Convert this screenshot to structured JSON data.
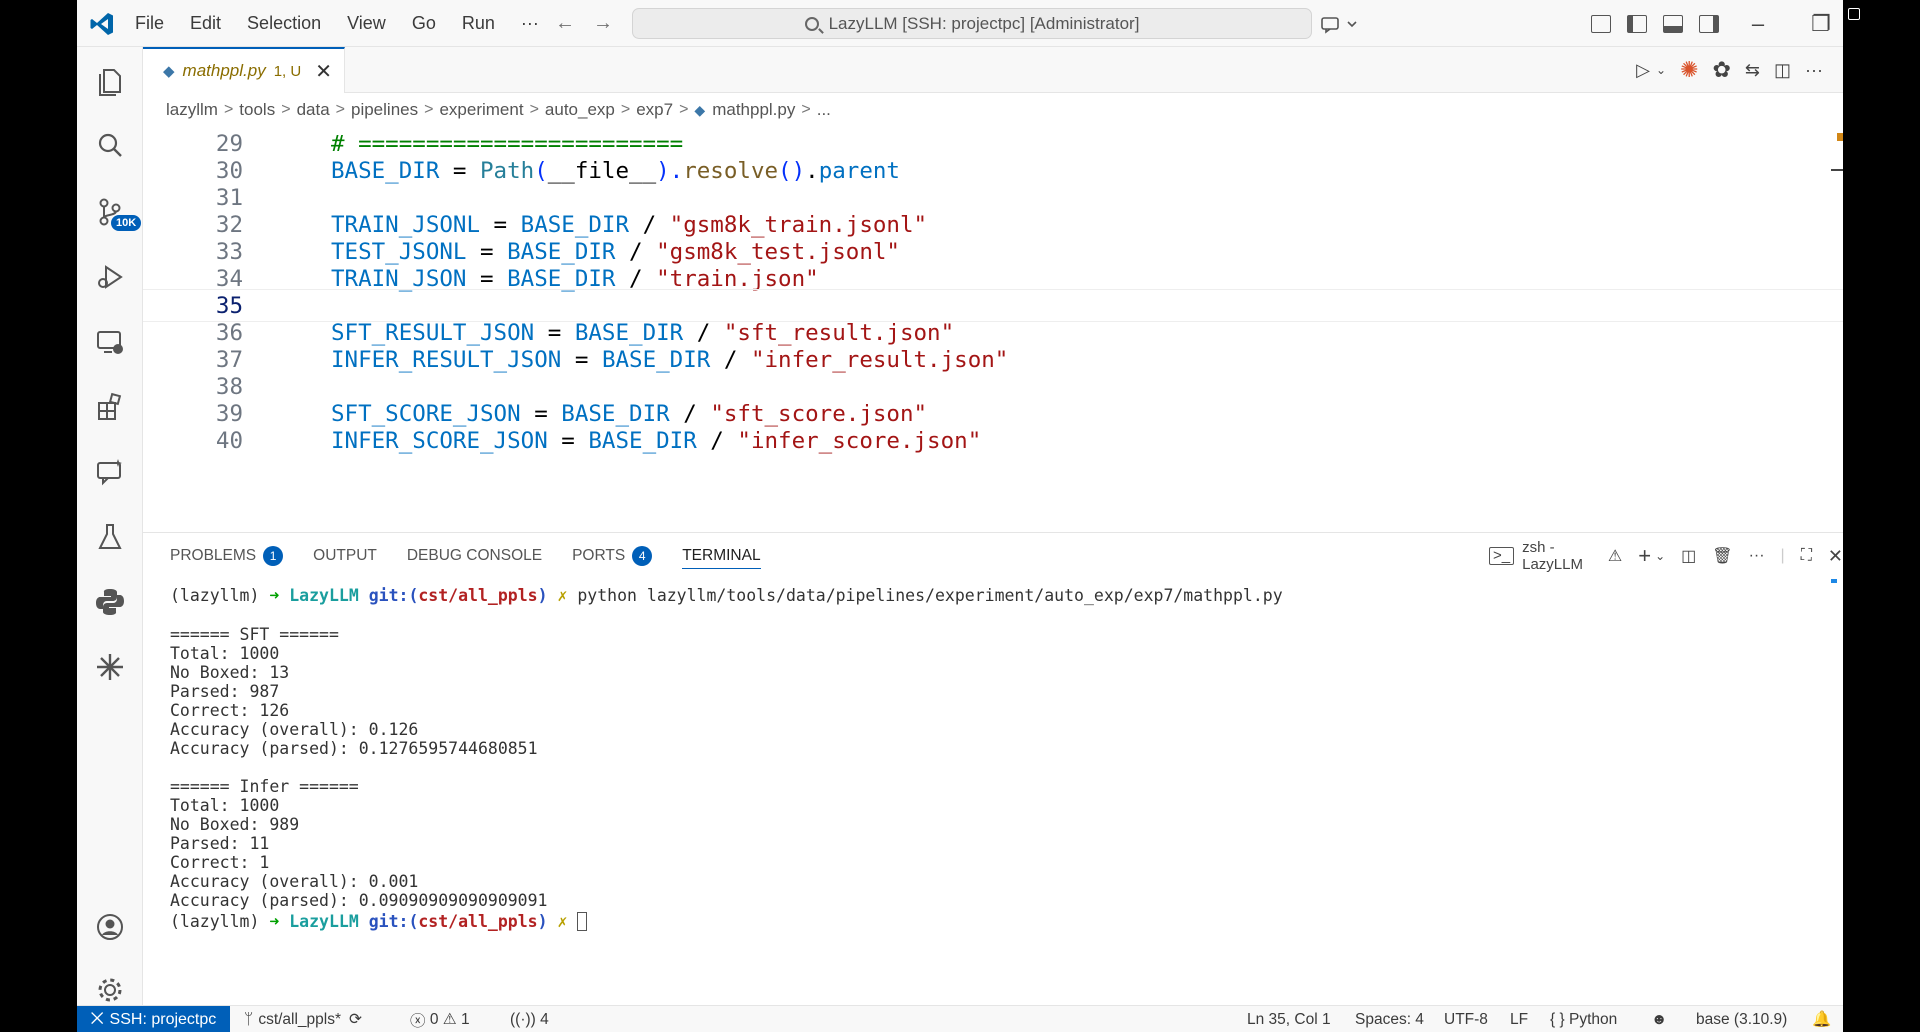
{
  "titlebar": {
    "menu": [
      "File",
      "Edit",
      "Selection",
      "View",
      "Go",
      "Run",
      "···"
    ],
    "command_center": "LazyLLM [SSH: projectpc] [Administrator]"
  },
  "activity": {
    "scm_badge": "10K"
  },
  "tab": {
    "name": "mathppl.py",
    "meta": "1, U"
  },
  "breadcrumb": [
    "lazyllm",
    "tools",
    "data",
    "pipelines",
    "experiment",
    "auto_exp",
    "exp7",
    "mathppl.py",
    "..."
  ],
  "editor": {
    "current_line": "35",
    "lines": [
      {
        "no": "29",
        "parts": [
          {
            "t": "# ========================",
            "c": "cmt"
          }
        ]
      },
      {
        "no": "30",
        "parts": [
          {
            "t": "BASE_DIR",
            "c": "var"
          },
          {
            "t": " = ",
            "c": "op"
          },
          {
            "t": "Path",
            "c": "cls"
          },
          {
            "t": "(",
            "c": "par"
          },
          {
            "t": "__file__",
            "c": "op"
          },
          {
            "t": ").",
            "c": "par"
          },
          {
            "t": "resolve",
            "c": "fn"
          },
          {
            "t": "()",
            "c": "par"
          },
          {
            "t": ".",
            "c": "op"
          },
          {
            "t": "parent",
            "c": "var"
          }
        ]
      },
      {
        "no": "31",
        "parts": []
      },
      {
        "no": "32",
        "parts": [
          {
            "t": "TRAIN_JSONL",
            "c": "var"
          },
          {
            "t": " = ",
            "c": "op"
          },
          {
            "t": "BASE_DIR",
            "c": "var"
          },
          {
            "t": " / ",
            "c": "op"
          },
          {
            "t": "\"gsm8k_train.jsonl\"",
            "c": "str"
          }
        ]
      },
      {
        "no": "33",
        "parts": [
          {
            "t": "TEST_JSONL",
            "c": "var"
          },
          {
            "t": " = ",
            "c": "op"
          },
          {
            "t": "BASE_DIR",
            "c": "var"
          },
          {
            "t": " / ",
            "c": "op"
          },
          {
            "t": "\"gsm8k_test.jsonl\"",
            "c": "str"
          }
        ]
      },
      {
        "no": "34",
        "parts": [
          {
            "t": "TRAIN_JSON",
            "c": "var"
          },
          {
            "t": " = ",
            "c": "op"
          },
          {
            "t": "BASE_DIR",
            "c": "var"
          },
          {
            "t": " / ",
            "c": "op"
          },
          {
            "t": "\"train.json\"",
            "c": "str"
          }
        ]
      },
      {
        "no": "35",
        "parts": []
      },
      {
        "no": "36",
        "parts": [
          {
            "t": "SFT_RESULT_JSON",
            "c": "var"
          },
          {
            "t": " = ",
            "c": "op"
          },
          {
            "t": "BASE_DIR",
            "c": "var"
          },
          {
            "t": " / ",
            "c": "op"
          },
          {
            "t": "\"sft_result.json\"",
            "c": "str"
          }
        ]
      },
      {
        "no": "37",
        "parts": [
          {
            "t": "INFER_RESULT_JSON",
            "c": "var"
          },
          {
            "t": " = ",
            "c": "op"
          },
          {
            "t": "BASE_DIR",
            "c": "var"
          },
          {
            "t": " / ",
            "c": "op"
          },
          {
            "t": "\"infer_result.json\"",
            "c": "str"
          }
        ]
      },
      {
        "no": "38",
        "parts": []
      },
      {
        "no": "39",
        "parts": [
          {
            "t": "SFT_SCORE_JSON",
            "c": "var"
          },
          {
            "t": " = ",
            "c": "op"
          },
          {
            "t": "BASE_DIR",
            "c": "var"
          },
          {
            "t": " / ",
            "c": "op"
          },
          {
            "t": "\"sft_score.json\"",
            "c": "str"
          }
        ]
      },
      {
        "no": "40",
        "parts": [
          {
            "t": "INFER_SCORE_JSON",
            "c": "var"
          },
          {
            "t": " = ",
            "c": "op"
          },
          {
            "t": "BASE_DIR",
            "c": "var"
          },
          {
            "t": " / ",
            "c": "op"
          },
          {
            "t": "\"infer_score.json\"",
            "c": "str"
          }
        ]
      }
    ]
  },
  "panel": {
    "tabs": [
      {
        "label": "PROBLEMS",
        "badge": "1"
      },
      {
        "label": "OUTPUT",
        "badge": ""
      },
      {
        "label": "DEBUG CONSOLE",
        "badge": ""
      },
      {
        "label": "PORTS",
        "badge": "4"
      },
      {
        "label": "TERMINAL",
        "badge": ""
      }
    ],
    "terminal_name": "zsh - LazyLLM"
  },
  "terminal": {
    "prompt": {
      "env": "(lazyllm)",
      "arrow": "➜",
      "dir": "LazyLLM",
      "git": "git:(",
      "branch": "cst/all_ppls",
      "git_close": ")",
      "dirty": "✗"
    },
    "command": "python lazyllm/tools/data/pipelines/experiment/auto_exp/exp7/mathppl.py",
    "output": [
      "====== SFT ======",
      "Total: 1000",
      "No Boxed: 13",
      "Parsed: 987",
      "Correct: 126",
      "Accuracy (overall): 0.126",
      "Accuracy (parsed): 0.1276595744680851",
      "",
      "====== Infer ======",
      "Total: 1000",
      "No Boxed: 989",
      "Parsed: 11",
      "Correct: 1",
      "Accuracy (overall): 0.001",
      "Accuracy (parsed): 0.09090909090909091"
    ]
  },
  "statusbar": {
    "remote": "SSH: projectpc",
    "branch": "cst/all_ppls*",
    "errors": "0",
    "warnings": "1",
    "ports": "4",
    "position": "Ln 35, Col 1",
    "spaces": "Spaces: 4",
    "encoding": "UTF-8",
    "eol": "LF",
    "language": "Python",
    "interpreter": "base (3.10.9)"
  },
  "colors": {
    "accent": "#005fb8",
    "string": "#a31515",
    "variable": "#0070c1",
    "comment": "#008000"
  }
}
